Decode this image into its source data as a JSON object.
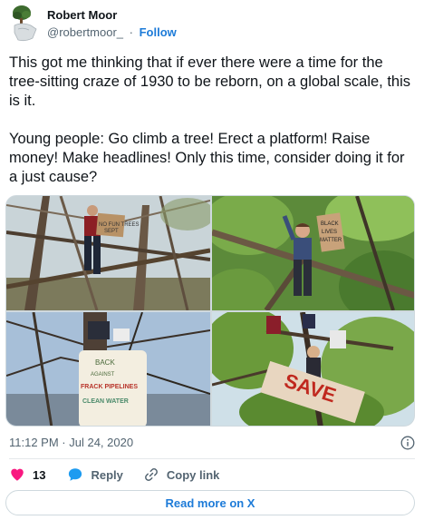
{
  "author": {
    "name": "Robert Moor",
    "handle": "@robertmoor_",
    "separator": "·",
    "follow_label": "Follow",
    "avatar_icon": "tree-statue-avatar"
  },
  "tweet": {
    "paragraphs": [
      "This got me thinking that if ever there were a time for the tree-sitting craze of 1930 to be reborn, on a global scale, this is it.",
      "Young people: Go climb a tree! Erect a platform! Raise money! Make headlines! Only this time, consider doing it for a just cause?"
    ]
  },
  "media": {
    "photos": [
      {
        "sign_lines": [
          "NO FUN TREES",
          "SEPT"
        ]
      },
      {
        "sign_lines": [
          "BLACK",
          "LIVES",
          "MATTER"
        ]
      },
      {
        "sign_lines": [
          "BACK",
          "AGAINST",
          "FRACK PIPELINES",
          "CLEAN WATER"
        ]
      },
      {
        "sign_lines": [
          "SAVE"
        ]
      }
    ]
  },
  "meta": {
    "timestamp": "11:12 PM · Jul 24, 2020",
    "info_icon": "info-circle-icon"
  },
  "actions": {
    "like_count": "13",
    "reply_label": "Reply",
    "copy_link_label": "Copy link"
  },
  "read_more_label": "Read more on X",
  "colors": {
    "accent": "#1d7bd8",
    "like": "#f91880",
    "secondary_text": "#536471"
  }
}
